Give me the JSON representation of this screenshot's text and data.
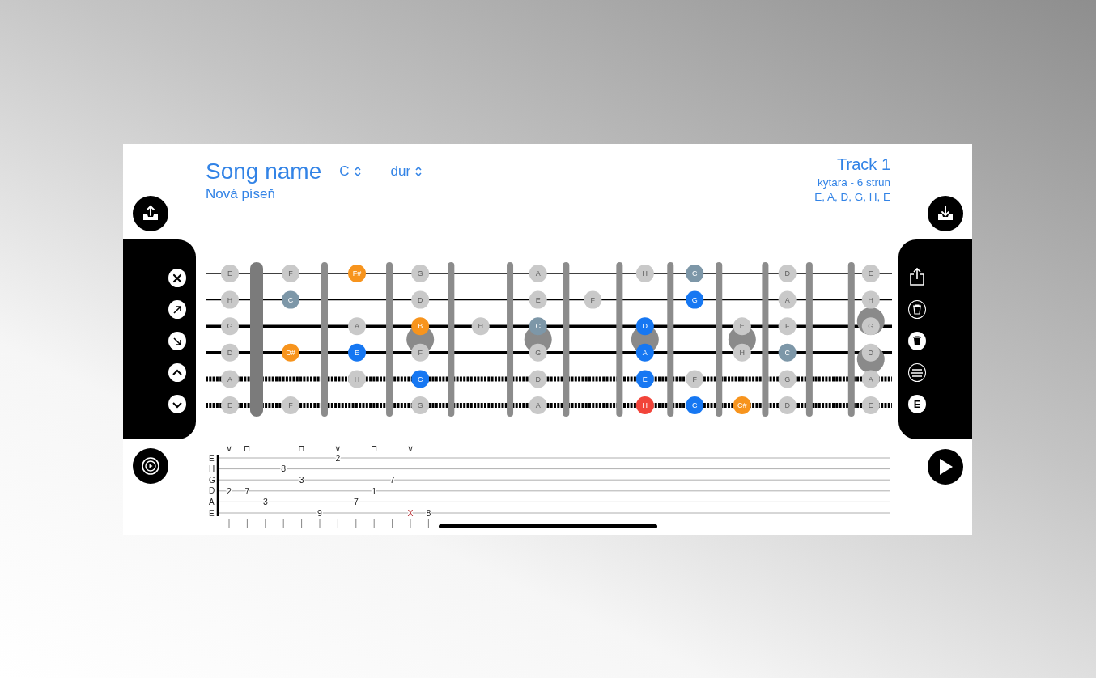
{
  "header": {
    "song_title": "Song name",
    "key": "C",
    "mode": "dur",
    "song_name": "Nová píseň",
    "track": "Track 1",
    "instrument": "kytara - 6 strun",
    "tuning": "E, A, D, G, H, E"
  },
  "left_toolbar": [
    {
      "kind": "close"
    },
    {
      "kind": "arrow-up-right"
    },
    {
      "kind": "arrow-down-right"
    },
    {
      "kind": "chevron-up"
    },
    {
      "kind": "chevron-down"
    }
  ],
  "right_toolbar": [
    {
      "kind": "share"
    },
    {
      "kind": "trash-outline"
    },
    {
      "kind": "trash-filled"
    },
    {
      "kind": "list"
    },
    {
      "kind": "letter",
      "label": "E"
    }
  ],
  "fretboard": {
    "strings": [
      {
        "kind": "thin",
        "notes": [
          {
            "kind": "note",
            "name": "E",
            "color": "#c9c9c9",
            "dimmed": true
          },
          {
            "kind": "note",
            "name": "F",
            "color": "#c9c9c9",
            "dimmed": true
          },
          {
            "kind": "note",
            "name": "F#",
            "color": "#f7941d",
            "dimmed": false
          },
          {
            "kind": "note",
            "name": "G",
            "color": "#c9c9c9",
            "dimmed": true
          },
          {
            "kind": "empty"
          },
          {
            "kind": "note",
            "name": "A",
            "color": "#c9c9c9",
            "dimmed": true
          },
          {
            "kind": "empty"
          },
          {
            "kind": "note",
            "name": "H",
            "color": "#c9c9c9",
            "dimmed": true
          },
          {
            "kind": "note",
            "name": "C",
            "color": "#7d97a8",
            "dimmed": false
          },
          {
            "kind": "empty"
          },
          {
            "kind": "note",
            "name": "D",
            "color": "#c9c9c9",
            "dimmed": true
          },
          {
            "kind": "empty"
          },
          {
            "kind": "note",
            "name": "E",
            "color": "#c9c9c9",
            "dimmed": true
          }
        ]
      },
      {
        "kind": "thin",
        "notes": [
          {
            "kind": "note",
            "name": "H",
            "color": "#c9c9c9",
            "dimmed": true
          },
          {
            "kind": "note",
            "name": "C",
            "color": "#7d97a8",
            "dimmed": false
          },
          {
            "kind": "empty"
          },
          {
            "kind": "note",
            "name": "D",
            "color": "#c9c9c9",
            "dimmed": true
          },
          {
            "kind": "empty"
          },
          {
            "kind": "note",
            "name": "E",
            "color": "#c9c9c9",
            "dimmed": true
          },
          {
            "kind": "note",
            "name": "F",
            "color": "#c9c9c9",
            "dimmed": true
          },
          {
            "kind": "empty"
          },
          {
            "kind": "note",
            "name": "G",
            "color": "#1677f2",
            "dimmed": false
          },
          {
            "kind": "empty"
          },
          {
            "kind": "note",
            "name": "A",
            "color": "#c9c9c9",
            "dimmed": true
          },
          {
            "kind": "empty"
          },
          {
            "kind": "note",
            "name": "H",
            "color": "#c9c9c9",
            "dimmed": true
          }
        ]
      },
      {
        "kind": "thick",
        "notes": [
          {
            "kind": "note",
            "name": "G",
            "color": "#c9c9c9",
            "dimmed": true
          },
          {
            "kind": "empty"
          },
          {
            "kind": "note",
            "name": "A",
            "color": "#c9c9c9",
            "dimmed": true
          },
          {
            "kind": "note",
            "name": "B",
            "color": "#f7941d",
            "dimmed": false
          },
          {
            "kind": "note",
            "name": "H",
            "color": "#c9c9c9",
            "dimmed": true
          },
          {
            "kind": "note",
            "name": "C",
            "color": "#7d97a8",
            "dimmed": false
          },
          {
            "kind": "empty"
          },
          {
            "kind": "note",
            "name": "D",
            "color": "#1677f2",
            "dimmed": false
          },
          {
            "kind": "empty"
          },
          {
            "kind": "note",
            "name": "E",
            "color": "#c9c9c9",
            "dimmed": true
          },
          {
            "kind": "note",
            "name": "F",
            "color": "#c9c9c9",
            "dimmed": true
          },
          {
            "kind": "empty"
          },
          {
            "kind": "note",
            "name": "G",
            "color": "#c9c9c9",
            "dimmed": true
          }
        ]
      },
      {
        "kind": "thick",
        "notes": [
          {
            "kind": "note",
            "name": "D",
            "color": "#c9c9c9",
            "dimmed": true
          },
          {
            "kind": "note",
            "name": "D#",
            "color": "#f7941d",
            "dimmed": false
          },
          {
            "kind": "note",
            "name": "E",
            "color": "#1677f2",
            "dimmed": false
          },
          {
            "kind": "note",
            "name": "F",
            "color": "#c9c9c9",
            "dimmed": true
          },
          {
            "kind": "empty"
          },
          {
            "kind": "note",
            "name": "G",
            "color": "#c9c9c9",
            "dimmed": true
          },
          {
            "kind": "empty"
          },
          {
            "kind": "note",
            "name": "A",
            "color": "#1677f2",
            "dimmed": false
          },
          {
            "kind": "empty"
          },
          {
            "kind": "note",
            "name": "H",
            "color": "#c9c9c9",
            "dimmed": true
          },
          {
            "kind": "note",
            "name": "C",
            "color": "#7d97a8",
            "dimmed": false
          },
          {
            "kind": "empty"
          },
          {
            "kind": "note",
            "name": "D",
            "color": "#c9c9c9",
            "dimmed": true
          }
        ]
      },
      {
        "kind": "wound",
        "notes": [
          {
            "kind": "note",
            "name": "A",
            "color": "#c9c9c9",
            "dimmed": true
          },
          {
            "kind": "empty"
          },
          {
            "kind": "note",
            "name": "H",
            "color": "#c9c9c9",
            "dimmed": true
          },
          {
            "kind": "note",
            "name": "C",
            "color": "#1677f2",
            "dimmed": false
          },
          {
            "kind": "empty"
          },
          {
            "kind": "note",
            "name": "D",
            "color": "#c9c9c9",
            "dimmed": true
          },
          {
            "kind": "empty"
          },
          {
            "kind": "note",
            "name": "E",
            "color": "#1677f2",
            "dimmed": false
          },
          {
            "kind": "note",
            "name": "F",
            "color": "#c9c9c9",
            "dimmed": true
          },
          {
            "kind": "empty"
          },
          {
            "kind": "note",
            "name": "G",
            "color": "#c9c9c9",
            "dimmed": true
          },
          {
            "kind": "empty"
          },
          {
            "kind": "note",
            "name": "A",
            "color": "#c9c9c9",
            "dimmed": true
          }
        ]
      },
      {
        "kind": "wound",
        "notes": [
          {
            "kind": "note",
            "name": "E",
            "color": "#c9c9c9",
            "dimmed": true
          },
          {
            "kind": "note",
            "name": "F",
            "color": "#c9c9c9",
            "dimmed": true
          },
          {
            "kind": "empty"
          },
          {
            "kind": "note",
            "name": "G",
            "color": "#c9c9c9",
            "dimmed": true
          },
          {
            "kind": "empty"
          },
          {
            "kind": "note",
            "name": "A",
            "color": "#c9c9c9",
            "dimmed": true
          },
          {
            "kind": "empty"
          },
          {
            "kind": "note",
            "name": "H",
            "color": "#f2443a",
            "dimmed": false
          },
          {
            "kind": "note",
            "name": "C",
            "color": "#1677f2",
            "dimmed": false
          },
          {
            "kind": "note",
            "name": "C#",
            "color": "#f7941d",
            "dimmed": false
          },
          {
            "kind": "note",
            "name": "D",
            "color": "#c9c9c9",
            "dimmed": true
          },
          {
            "kind": "empty"
          },
          {
            "kind": "note",
            "name": "E",
            "color": "#c9c9c9",
            "dimmed": true
          }
        ]
      }
    ]
  },
  "tab": {
    "strings": [
      "E",
      "H",
      "G",
      "D",
      "A",
      "E"
    ],
    "beats": [
      {
        "stroke": "∨",
        "cells": [
          {
            "kind": "empty"
          },
          {
            "kind": "empty"
          },
          {
            "kind": "empty"
          },
          {
            "kind": "fret",
            "text": "2"
          },
          {
            "kind": "empty"
          },
          {
            "kind": "empty"
          }
        ]
      },
      {
        "stroke": "⊓",
        "cells": [
          {
            "kind": "empty"
          },
          {
            "kind": "empty"
          },
          {
            "kind": "empty"
          },
          {
            "kind": "fret",
            "text": "7"
          },
          {
            "kind": "empty"
          },
          {
            "kind": "empty"
          }
        ]
      },
      {
        "cells": [
          {
            "kind": "empty"
          },
          {
            "kind": "empty"
          },
          {
            "kind": "empty"
          },
          {
            "kind": "empty"
          },
          {
            "kind": "fret",
            "text": "3"
          },
          {
            "kind": "empty"
          }
        ]
      },
      {
        "cells": [
          {
            "kind": "empty"
          },
          {
            "kind": "fret",
            "text": "8"
          },
          {
            "kind": "empty"
          },
          {
            "kind": "empty"
          },
          {
            "kind": "empty"
          },
          {
            "kind": "empty"
          }
        ]
      },
      {
        "stroke": "⊓",
        "cells": [
          {
            "kind": "empty"
          },
          {
            "kind": "empty"
          },
          {
            "kind": "fret",
            "text": "3"
          },
          {
            "kind": "empty"
          },
          {
            "kind": "empty"
          },
          {
            "kind": "empty"
          }
        ]
      },
      {
        "cells": [
          {
            "kind": "empty"
          },
          {
            "kind": "empty"
          },
          {
            "kind": "empty"
          },
          {
            "kind": "empty"
          },
          {
            "kind": "empty"
          },
          {
            "kind": "fret",
            "text": "9"
          }
        ]
      },
      {
        "stroke": "∨",
        "cells": [
          {
            "kind": "fret",
            "text": "2"
          },
          {
            "kind": "empty"
          },
          {
            "kind": "empty"
          },
          {
            "kind": "empty"
          },
          {
            "kind": "empty"
          },
          {
            "kind": "empty"
          }
        ]
      },
      {
        "cells": [
          {
            "kind": "empty"
          },
          {
            "kind": "empty"
          },
          {
            "kind": "empty"
          },
          {
            "kind": "empty"
          },
          {
            "kind": "fret",
            "text": "7"
          },
          {
            "kind": "empty"
          }
        ]
      },
      {
        "stroke": "⊓",
        "cells": [
          {
            "kind": "empty"
          },
          {
            "kind": "empty"
          },
          {
            "kind": "empty"
          },
          {
            "kind": "fret",
            "text": "1"
          },
          {
            "kind": "empty"
          },
          {
            "kind": "empty"
          }
        ]
      },
      {
        "cells": [
          {
            "kind": "empty"
          },
          {
            "kind": "empty"
          },
          {
            "kind": "fret",
            "text": "7"
          },
          {
            "kind": "empty"
          },
          {
            "kind": "empty"
          },
          {
            "kind": "empty"
          }
        ]
      },
      {
        "stroke": "∨",
        "cells": [
          {
            "kind": "empty"
          },
          {
            "kind": "empty"
          },
          {
            "kind": "empty"
          },
          {
            "kind": "empty"
          },
          {
            "kind": "empty"
          },
          {
            "kind": "muted",
            "text": "X"
          }
        ]
      },
      {
        "cells": [
          {
            "kind": "empty"
          },
          {
            "kind": "empty"
          },
          {
            "kind": "empty"
          },
          {
            "kind": "empty"
          },
          {
            "kind": "empty"
          },
          {
            "kind": "fret",
            "text": "8"
          }
        ]
      }
    ]
  }
}
